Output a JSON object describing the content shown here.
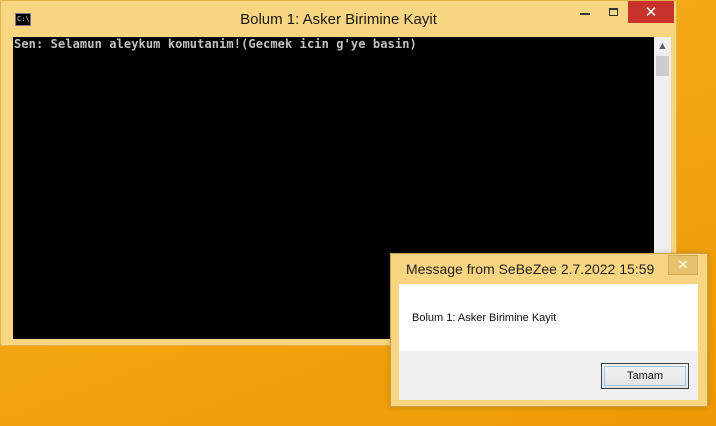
{
  "console": {
    "title": "Bolum 1: Asker Birimine Kayit",
    "app_icon_text": "C:\\",
    "close_glyph": "✕",
    "output_line": "Sen: Selamun aleykum komutanim!(Gecmek icin g'ye basin)"
  },
  "dialog": {
    "title": "Message from SeBeZee 2.7.2022 15:59",
    "close_glyph": "✕",
    "message": "Bolum 1: Asker Birimine Kayit",
    "ok_label": "Tamam"
  },
  "colors": {
    "desktop": "#f2a20f",
    "window_frame": "#f8d580",
    "close_red": "#c7322b",
    "console_bg": "#000000",
    "console_text": "#c0c0c0"
  },
  "icons": {
    "console_app": "console-icon",
    "minimize": "minimize-icon",
    "maximize": "maximize-icon",
    "close": "close-icon",
    "scroll_up": "chevron-up-icon"
  }
}
